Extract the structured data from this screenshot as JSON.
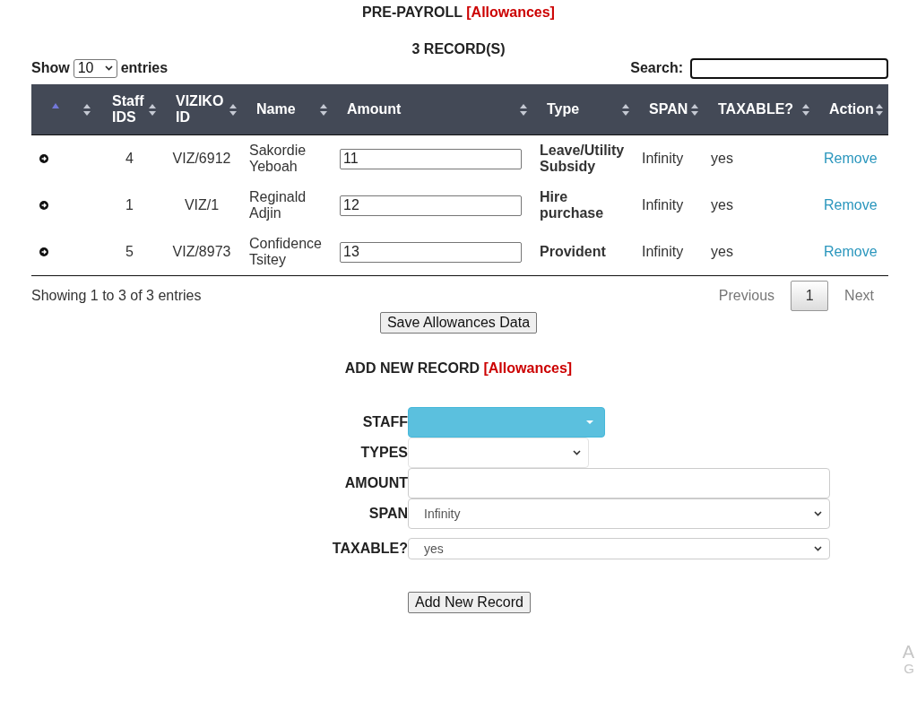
{
  "title": {
    "text": "PRE-PAYROLL",
    "tag": "[Allowances]"
  },
  "record_count": "3 RECORD(S)",
  "length_menu": {
    "prefix": "Show",
    "value": "10",
    "suffix": "entries"
  },
  "search": {
    "label": "Search:"
  },
  "table": {
    "columns": [
      {
        "sorted": true
      },
      {
        "sorted": false
      },
      {
        "label": "Staff IDS",
        "sorted": false
      },
      {
        "label": "VIZIKO ID",
        "sorted": false
      },
      {
        "label": "Name",
        "sorted": false
      },
      {
        "label": "Amount",
        "sorted": false
      },
      {
        "label": "Type",
        "sorted": false
      },
      {
        "label": "SPAN",
        "sorted": false
      },
      {
        "label": "TAXABLE?",
        "sorted": false
      },
      {
        "label": "Action",
        "sorted": false
      }
    ],
    "rows": [
      {
        "staff_id": "4",
        "viziko_id": "VIZ/6912",
        "name": "Sakordie Yeboah",
        "amount": "11",
        "type": "Leave/Utility Subsidy",
        "span": "Infinity",
        "taxable": "yes",
        "action": "Remove"
      },
      {
        "staff_id": "1",
        "viziko_id": "VIZ/1",
        "name": "Reginald Adjin",
        "amount": "12",
        "type": "Hire purchase",
        "span": "Infinity",
        "taxable": "yes",
        "action": "Remove"
      },
      {
        "staff_id": "5",
        "viziko_id": "VIZ/8973",
        "name": "Confidence Tsitey",
        "amount": "13",
        "type": "Provident",
        "span": "Infinity",
        "taxable": "yes",
        "action": "Remove"
      }
    ]
  },
  "info": "Showing 1 to 3 of 3 entries",
  "pagination": {
    "previous": {
      "label": "Previous",
      "disabled": true
    },
    "pages": [
      {
        "label": "1",
        "selected": true
      }
    ],
    "next": {
      "label": "Next",
      "disabled": true
    }
  },
  "save_button": "Save Allowances Data",
  "form": {
    "title": {
      "text": "ADD NEW RECORD",
      "tag": "[Allowances]"
    },
    "fields": [
      {
        "label": "STAFF",
        "kind": "dropdown-button"
      },
      {
        "label": "TYPES",
        "kind": "short-select"
      },
      {
        "label": "AMOUNT",
        "kind": "input"
      },
      {
        "label": "SPAN",
        "kind": "select",
        "value": "Infinity"
      },
      {
        "label": "TAXABLE?",
        "kind": "select",
        "value": "yes"
      }
    ],
    "submit": "Add New Record"
  },
  "os_overlay": {
    "lines": [
      "A",
      "G"
    ]
  }
}
